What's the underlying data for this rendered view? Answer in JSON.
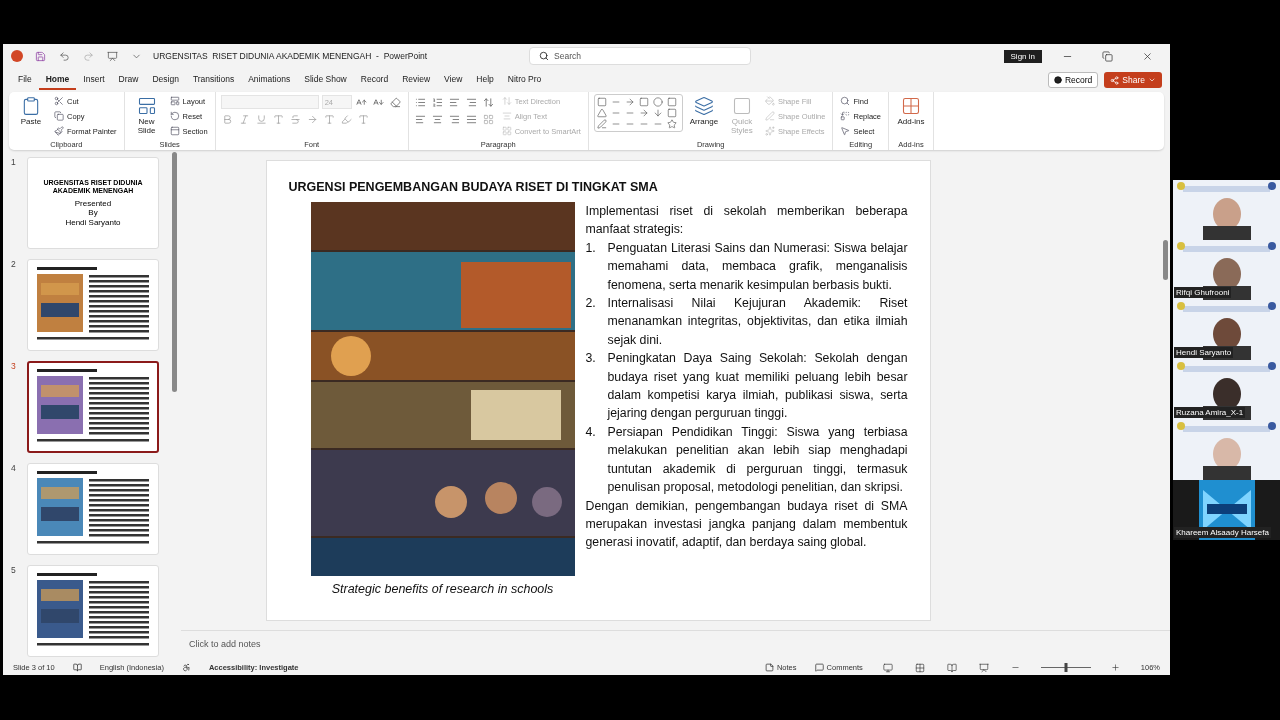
{
  "window": {
    "title": "URGENSITAS  RISET DIDUNIA AKADEMIK MENENGAH  -  PowerPoint",
    "search_placeholder": "Search",
    "sign_in": "Sign in"
  },
  "menu_tabs": [
    {
      "label": "File",
      "selected": false
    },
    {
      "label": "Home",
      "selected": true
    },
    {
      "label": "Insert",
      "selected": false
    },
    {
      "label": "Draw",
      "selected": false
    },
    {
      "label": "Design",
      "selected": false
    },
    {
      "label": "Transitions",
      "selected": false
    },
    {
      "label": "Animations",
      "selected": false
    },
    {
      "label": "Slide Show",
      "selected": false
    },
    {
      "label": "Record",
      "selected": false
    },
    {
      "label": "Review",
      "selected": false
    },
    {
      "label": "View",
      "selected": false
    },
    {
      "label": "Help",
      "selected": false
    },
    {
      "label": "Nitro Pro",
      "selected": false
    }
  ],
  "record_button": "Record",
  "share_button": "Share",
  "ribbon": [
    {
      "kind": "clipboard",
      "label": "Clipboard",
      "commands": [
        {
          "label": "Paste",
          "kind": "large",
          "disabled": false
        },
        {
          "label": "Cut",
          "kind": "small",
          "disabled": false
        },
        {
          "label": "Copy",
          "kind": "small",
          "disabled": false
        },
        {
          "label": "Format Painter",
          "kind": "small",
          "disabled": false
        }
      ]
    },
    {
      "kind": "slides",
      "label": "Slides",
      "commands": [
        {
          "label": "New Slide",
          "kind": "large",
          "disabled": false
        },
        {
          "label": "Layout",
          "kind": "small",
          "disabled": false
        },
        {
          "label": "Reset",
          "kind": "small",
          "disabled": false
        },
        {
          "label": "Section",
          "kind": "small",
          "disabled": false
        }
      ]
    },
    {
      "kind": "font",
      "label": "Font",
      "font_size": "24"
    },
    {
      "kind": "paragraph",
      "label": "Paragraph",
      "commands": [
        {
          "label": "Text Direction",
          "kind": "small",
          "disabled": true
        },
        {
          "label": "Align Text",
          "kind": "small",
          "disabled": true
        },
        {
          "label": "Convert to SmartArt",
          "kind": "small",
          "disabled": true
        }
      ]
    },
    {
      "kind": "drawing",
      "label": "Drawing",
      "commands": [
        {
          "label": "Arrange",
          "kind": "large",
          "disabled": false
        },
        {
          "label": "Quick Styles",
          "kind": "large",
          "disabled": true
        },
        {
          "label": "Shape Fill",
          "kind": "small",
          "disabled": true
        },
        {
          "label": "Shape Outline",
          "kind": "small",
          "disabled": true
        },
        {
          "label": "Shape Effects",
          "kind": "small",
          "disabled": true
        }
      ]
    },
    {
      "kind": "editing",
      "label": "Editing",
      "commands": [
        {
          "label": "Find",
          "kind": "small",
          "disabled": false
        },
        {
          "label": "Replace",
          "kind": "small",
          "disabled": false
        },
        {
          "label": "Select",
          "kind": "small",
          "disabled": false
        }
      ]
    },
    {
      "kind": "addins",
      "label": "Add-ins",
      "commands": [
        {
          "label": "Add-ins",
          "kind": "large",
          "disabled": false
        }
      ]
    }
  ],
  "thumbnails": [
    {
      "number": "1",
      "selected": false,
      "kind": "title",
      "title": "URGENSITAS  RISET DIDUNIA AKADEMIK MENENGAH",
      "lines": [
        "Presented",
        "By",
        "Hendi Saryanto"
      ]
    },
    {
      "number": "2",
      "selected": false,
      "kind": "content"
    },
    {
      "number": "3",
      "selected": true,
      "kind": "content"
    },
    {
      "number": "4",
      "selected": false,
      "kind": "content"
    },
    {
      "number": "5",
      "selected": false,
      "kind": "content"
    }
  ],
  "slide": {
    "title": "URGENSI PENGEMBANGAN BUDAYA RISET DI TINGKAT SMA",
    "caption": "Strategic benefits of research in schools",
    "intro": "Implementasi riset di sekolah memberikan beberapa manfaat strategis:",
    "points": [
      {
        "number": "1.",
        "text": "Penguatan Literasi Sains dan Numerasi: Siswa belajar memahami data, membaca grafik, menganalisis fenomena, serta menarik kesimpulan berbasis bukti."
      },
      {
        "number": "2.",
        "text": "Internalisasi Nilai Kejujuran Akademik: Riset menanamkan integritas, objektivitas, dan etika ilmiah sejak dini."
      },
      {
        "number": "3.",
        "text": "Peningkatan Daya Saing Sekolah: Sekolah dengan budaya riset yang kuat memiliki peluang lebih besar dalam kompetisi karya ilmiah, publikasi siswa, serta jejaring dengan perguruan tinggi."
      },
      {
        "number": "4.",
        "text": "Persiapan Pendidikan Tinggi: Siswa yang terbiasa melakukan penelitian akan lebih siap menghadapi tuntutan akademik di perguruan tinggi, termasuk penulisan proposal, metodologi penelitian, dan skripsi."
      }
    ],
    "conclusion": "Dengan demikian, pengembangan budaya riset di SMA merupakan investasi jangka panjang dalam membentuk generasi inovatif, adaptif, dan berdaya saing global."
  },
  "notes_placeholder": "Click to add notes",
  "status_bar": {
    "slide": "Slide 3 of 10",
    "language": "English (Indonesia)",
    "accessibility": "Accessibility: Investigate",
    "notes": "Notes",
    "comments": "Comments",
    "zoom": "106%",
    "zoom_slider": {
      "level": 0.5
    }
  },
  "participants": [
    {
      "kind": "camera"
    },
    {
      "kind": "camera",
      "name": "Rifqi Ghufrooni"
    },
    {
      "kind": "camera",
      "name": "Hendi Saryanto"
    },
    {
      "kind": "camera",
      "name": "Ruzana Amira_X-1"
    },
    {
      "kind": "camera"
    },
    {
      "kind": "avatar",
      "name": "Khareem Alsaady Harsefa"
    }
  ]
}
